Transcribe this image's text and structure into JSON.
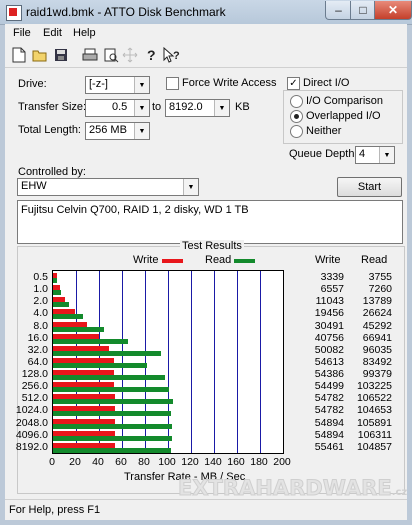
{
  "window": {
    "title": "raid1wd.bmk - ATTO Disk Benchmark",
    "minimize": "–",
    "maximize": "□",
    "close": "✕"
  },
  "menu": [
    "File",
    "Edit",
    "Help"
  ],
  "toolbar": [
    "new-icon",
    "open-icon",
    "save-icon",
    "print-icon",
    "print-preview-icon",
    "move-icon",
    "help-icon",
    "context-help-icon"
  ],
  "form": {
    "drive_label": "Drive:",
    "drive_value": "[-z-]",
    "force_write_label": "Force Write Access",
    "force_write_checked": false,
    "direct_io_label": "Direct I/O",
    "direct_io_checked": true,
    "transfer_size_label": "Transfer Size:",
    "transfer_from": "0.5",
    "to_label": "to",
    "transfer_to": "8192.0",
    "kb_label": "KB",
    "total_length_label": "Total Length:",
    "total_length_value": "256 MB",
    "io_options": [
      {
        "label": "I/O Comparison",
        "selected": false
      },
      {
        "label": "Overlapped I/O",
        "selected": true
      },
      {
        "label": "Neither",
        "selected": false
      }
    ],
    "queue_depth_label": "Queue Depth:",
    "queue_depth_value": "4",
    "controlled_by_label": "Controlled by:",
    "controlled_by_value": "EHW",
    "start_label": "Start",
    "description": "Fujitsu Celvin Q700, RAID 1, 2 disky, WD 1 TB"
  },
  "results": {
    "group_title": "Test Results",
    "write_legend": "Write",
    "read_legend": "Read",
    "write_col": "Write",
    "read_col": "Read",
    "write_color": "#e8161b",
    "read_color": "#138a2c",
    "xaxis_label": "Transfer Rate - MB / Sec"
  },
  "chart_data": {
    "type": "bar",
    "orientation": "horizontal",
    "xlabel": "Transfer Rate - MB / Sec",
    "xlim": [
      0,
      200
    ],
    "xticks": [
      "0",
      "20",
      "40",
      "60",
      "80",
      "100",
      "120",
      "140",
      "160",
      "180",
      "200"
    ],
    "categories": [
      "0.5",
      "1.0",
      "2.0",
      "4.0",
      "8.0",
      "16.0",
      "32.0",
      "64.0",
      "128.0",
      "256.0",
      "512.0",
      "1024.0",
      "2048.0",
      "4096.0",
      "8192.0"
    ],
    "series": [
      {
        "name": "Write",
        "values": [
          3.3,
          6.4,
          10.8,
          19.0,
          29.8,
          39.8,
          48.9,
          53.3,
          53.1,
          53.2,
          53.5,
          53.5,
          53.6,
          53.6,
          54.2
        ]
      },
      {
        "name": "Read",
        "values": [
          3.7,
          7.1,
          13.5,
          26.0,
          44.2,
          65.4,
          93.8,
          81.5,
          97.0,
          100.8,
          104.0,
          102.2,
          103.4,
          103.8,
          102.4
        ]
      }
    ],
    "table_write": [
      "3339",
      "6557",
      "11043",
      "19456",
      "30491",
      "40756",
      "50082",
      "54613",
      "54386",
      "54499",
      "54782",
      "54782",
      "54894",
      "54894",
      "55461"
    ],
    "table_read": [
      "3755",
      "7260",
      "13789",
      "26624",
      "45292",
      "66941",
      "96035",
      "83492",
      "99379",
      "103225",
      "106522",
      "104653",
      "105891",
      "106311",
      "104857"
    ]
  },
  "status": "For Help, press F1",
  "watermark": {
    "main": "EXTRAHARDWARE",
    "suffix": ".cz"
  }
}
